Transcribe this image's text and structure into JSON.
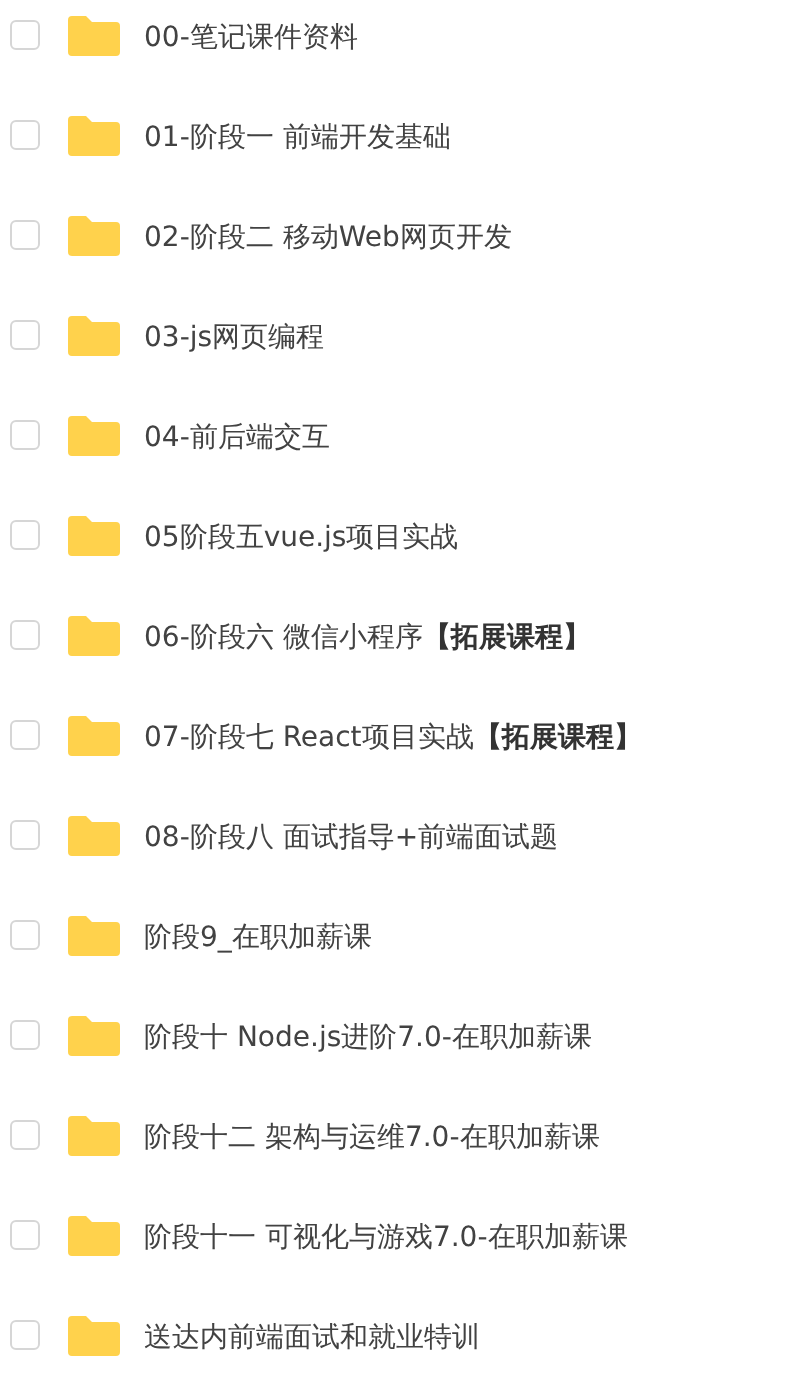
{
  "files": [
    {
      "name": "00-笔记课件资料",
      "checked": false
    },
    {
      "name": "01-阶段一 前端开发基础",
      "checked": false
    },
    {
      "name": "02-阶段二 移动Web网页开发",
      "checked": false
    },
    {
      "name": "03-js网页编程",
      "checked": false
    },
    {
      "name": "04-前后端交互",
      "checked": false
    },
    {
      "name": "05阶段五vue.js项目实战",
      "checked": false
    },
    {
      "name": "06-阶段六 微信小程序**【拓展课程】**",
      "checked": false
    },
    {
      "name": "07-阶段七 React项目实战**【拓展课程】**",
      "checked": false
    },
    {
      "name": "08-阶段八 面试指导+前端面试题",
      "checked": false
    },
    {
      "name": "阶段9_在职加薪课",
      "checked": false
    },
    {
      "name": "阶段十 Node.js进阶7.0-在职加薪课",
      "checked": false
    },
    {
      "name": "阶段十二 架构与运维7.0-在职加薪课",
      "checked": false
    },
    {
      "name": "阶段十一 可视化与游戏7.0-在职加薪课",
      "checked": false
    },
    {
      "name": "送达内前端面试和就业特训",
      "checked": false
    }
  ]
}
